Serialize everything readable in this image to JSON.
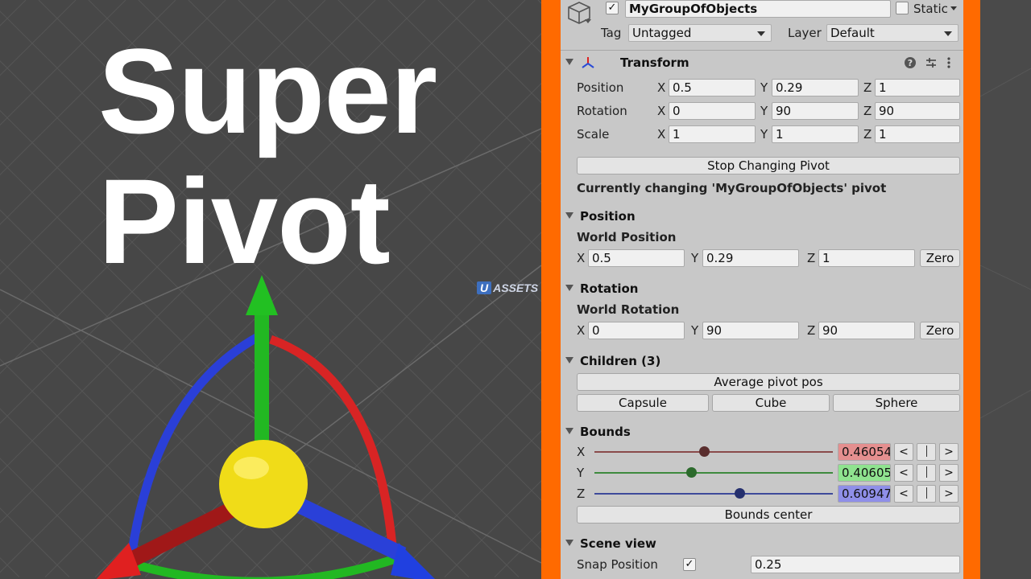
{
  "scene": {
    "title_line1": "Super",
    "title_line2": "Pivot",
    "watermark_u": "U",
    "watermark_text": "ASSETS"
  },
  "header": {
    "object_name": "MyGroupOfObjects",
    "active_checked": true,
    "static_label": "Static",
    "tag_label": "Tag",
    "tag_value": "Untagged",
    "layer_label": "Layer",
    "layer_value": "Default"
  },
  "transform": {
    "title": "Transform",
    "rows": [
      {
        "label": "Position",
        "x": "0.5",
        "y": "0.29",
        "z": "1"
      },
      {
        "label": "Rotation",
        "x": "0",
        "y": "90",
        "z": "90"
      },
      {
        "label": "Scale",
        "x": "1",
        "y": "1",
        "z": "1"
      }
    ],
    "axis_x": "X",
    "axis_y": "Y",
    "axis_z": "Z"
  },
  "pivot": {
    "stop_button": "Stop Changing Pivot",
    "status": "Currently changing 'MyGroupOfObjects' pivot",
    "position_section": "Position",
    "world_position_label": "World Position",
    "world_position": {
      "x": "0.5",
      "y": "0.29",
      "z": "1"
    },
    "rotation_section": "Rotation",
    "world_rotation_label": "World Rotation",
    "world_rotation": {
      "x": "0",
      "y": "90",
      "z": "90"
    },
    "zero_button": "Zero"
  },
  "children": {
    "title": "Children (3)",
    "average_button": "Average pivot pos",
    "items": [
      "Capsule",
      "Cube",
      "Sphere"
    ]
  },
  "bounds": {
    "title": "Bounds",
    "sliders": [
      {
        "axis": "X",
        "value": "0.46054",
        "fraction": 0.46,
        "color": "#e58f8f",
        "track": "#8a4b4b",
        "knob": "#5a2e2e"
      },
      {
        "axis": "Y",
        "value": "0.40605",
        "fraction": 0.406,
        "color": "#8fe38f",
        "track": "#3e8a3e",
        "knob": "#2c6a2c"
      },
      {
        "axis": "Z",
        "value": "0.60947",
        "fraction": 0.609,
        "color": "#8f8fe8",
        "track": "#3e4a9a",
        "knob": "#25306e"
      }
    ],
    "prev": "<",
    "next": ">",
    "center_button": "Bounds center"
  },
  "scene_view": {
    "title": "Scene view",
    "snap_label": "Snap Position",
    "snap_checked": true,
    "snap_value": "0.25"
  },
  "colors": {
    "frame": "#ff6a00",
    "inspector_bg": "#c8c8c8",
    "gizmo_x": "#e02020",
    "gizmo_y": "#22c022",
    "gizmo_z": "#2040e0",
    "gizmo_center": "#f2e020"
  },
  "icons": {
    "gameobject": "cube-icon",
    "transform": "transform-axes-icon",
    "help": "help-icon",
    "presets": "sliders-icon",
    "menu": "kebab-menu-icon"
  }
}
